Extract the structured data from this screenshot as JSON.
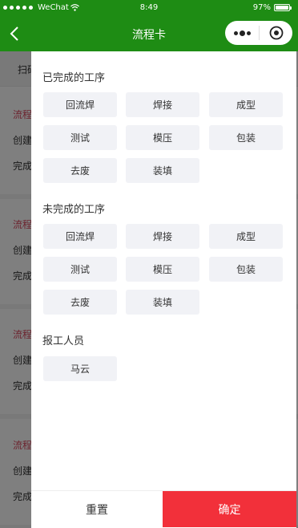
{
  "status_bar": {
    "carrier": "WeChat",
    "time": "8:49",
    "battery": "97%",
    "battery_level": 0.97
  },
  "nav": {
    "title": "流程卡",
    "back_icon": "chevron-left-icon",
    "more_icon": "more-dots-icon",
    "close_icon": "target-close-icon"
  },
  "background_list": {
    "tab_label": "扫码",
    "cards": [
      {
        "title": "流程",
        "created": "创建",
        "completed": "完成"
      },
      {
        "title": "流程",
        "created": "创建",
        "completed": "完成"
      },
      {
        "title": "流程",
        "created": "创建",
        "completed": "完成"
      },
      {
        "title": "流程",
        "created": "创建",
        "completed": "完成"
      }
    ]
  },
  "filter": {
    "completed_title": "已完成的工序",
    "completed_options": [
      "回流焊",
      "焊接",
      "成型",
      "测试",
      "模压",
      "包装",
      "去废",
      "装填"
    ],
    "uncompleted_title": "未完成的工序",
    "uncompleted_options": [
      "回流焊",
      "焊接",
      "成型",
      "测试",
      "模压",
      "包装",
      "去废",
      "装填"
    ],
    "reporter_title": "报工人员",
    "reporter_options": [
      "马云"
    ]
  },
  "footer": {
    "reset_label": "重置",
    "confirm_label": "确定"
  },
  "colors": {
    "nav_green": "#1e8c14",
    "confirm_red": "#f2303a",
    "chip_bg": "#f1f2f6",
    "card_title_red": "#d9485e"
  }
}
